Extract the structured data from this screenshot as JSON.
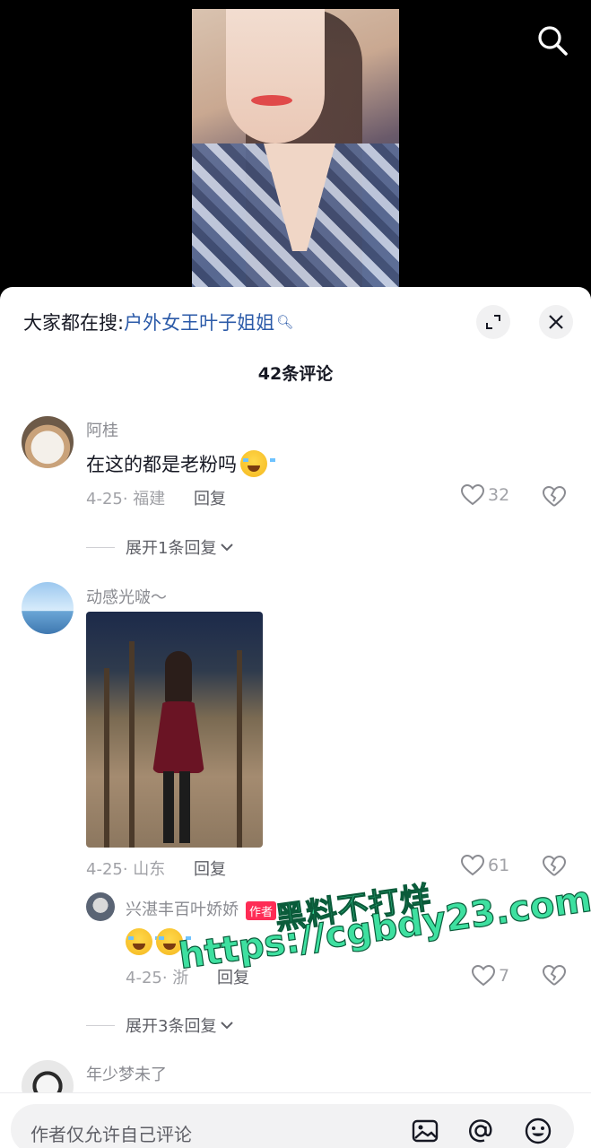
{
  "video": {
    "search_icon": "search-icon"
  },
  "sheet": {
    "hot_search_prefix": "大家都在搜:",
    "hot_search_keyword": "户外女王叶子姐姐",
    "comment_count": "42条评论"
  },
  "comments": [
    {
      "username": "阿桂",
      "text": "在这的都是老粉吗",
      "date_location": "4-25· 福建",
      "reply_label": "回复",
      "likes": "32",
      "expand_label": "展开1条回复"
    },
    {
      "username": "动感光啵～",
      "date_location": "4-25· 山东",
      "reply_label": "回复",
      "likes": "61",
      "sub_reply": {
        "username": "兴湛丰百叶娇娇",
        "author_tag": "作者",
        "date_location": "4-25· 浙",
        "reply_label": "回复",
        "likes": "7"
      },
      "expand_label": "展开3条回复"
    },
    {
      "username": "年少梦未了"
    }
  ],
  "watermark": {
    "line1": "黑料不打烊",
    "line2": "https://cgbdy23.com"
  },
  "bottom_bar": {
    "placeholder": "作者仅允许自己评论"
  }
}
